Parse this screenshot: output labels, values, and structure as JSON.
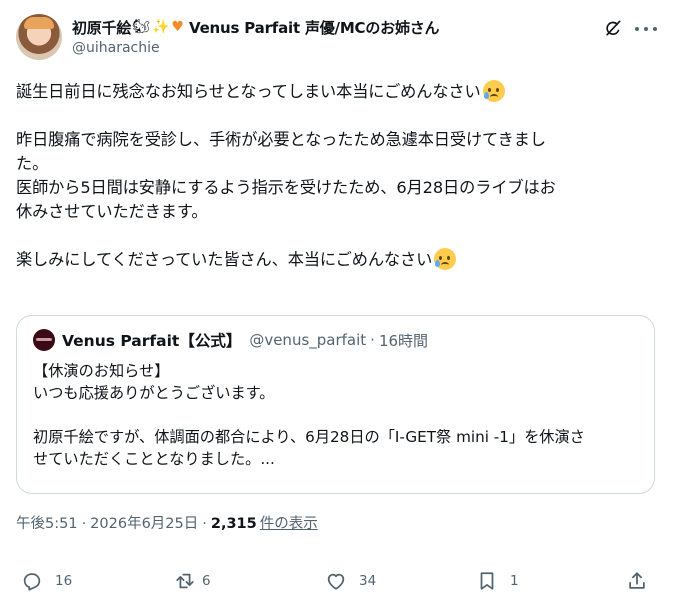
{
  "author": {
    "display_name": "初原千絵",
    "display_name_suffix": "Venus Parfait 声優/MCのお姉さん",
    "emojis": [
      "squirrel-emoji",
      "magic-wand-emoji",
      "orange-heart-emoji"
    ],
    "handle": "@uiharachie"
  },
  "tweet": {
    "lines": [
      "誕生日前日に残念なお知らせとなってしまい本当にごめんなさい",
      "",
      "昨日腹痛で病院を受診し、手術が必要となったため急遽本日受けてきまし",
      "た。",
      "医師から5日間は安静にするよう指示を受けたため、6月28日のライブはお",
      "休みさせていただきます。",
      "",
      "楽しみにしてくださっていた皆さん、本当にごめんなさい"
    ],
    "emoji_icon": "sad-but-relieved-face-emoji"
  },
  "quote": {
    "name": "Venus Parfait【公式】",
    "handle": "@venus_parfait",
    "time": "16時間",
    "lines": [
      "【休演のお知らせ】",
      "いつも応援ありがとうございます。",
      "",
      "初原千絵ですが、体調面の都合により、6月28日の「I-GET祭 mini -1」を休演さ",
      "せていただくこととなりました。..."
    ]
  },
  "meta": {
    "time": "午後5:51",
    "date": "2026年6月25日",
    "views_count": "2,315",
    "views_label": "件の表示"
  },
  "actions": {
    "replies": "16",
    "reposts": "6",
    "likes": "34",
    "bookmarks": "1"
  },
  "colors": {
    "text": "#0f1419",
    "secondary": "#536471",
    "border": "#cfd9de"
  }
}
